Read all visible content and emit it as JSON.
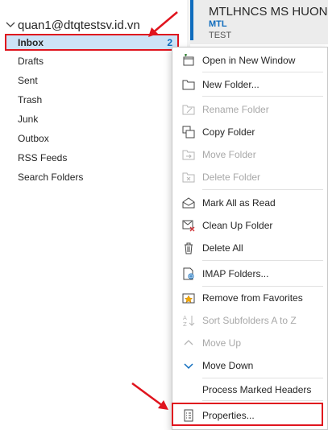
{
  "folder_pane": {
    "account": "quan1@dtqtestsv.id.vn",
    "inbox": {
      "label": "Inbox",
      "count": "2"
    },
    "folders": [
      "Drafts",
      "Sent",
      "Trash",
      "Junk",
      "Outbox",
      "RSS Feeds",
      "Search Folders"
    ]
  },
  "message": {
    "sender": "MTLHNCS MS HUONG",
    "tag": "MTL",
    "subject": "TEST"
  },
  "context_menu": {
    "open_new_window": "Open in New Window",
    "new_folder": "New Folder...",
    "rename_folder": "Rename Folder",
    "copy_folder": "Copy Folder",
    "move_folder": "Move Folder",
    "delete_folder": "Delete Folder",
    "mark_all_read": "Mark All as Read",
    "clean_up_folder": "Clean Up Folder",
    "delete_all": "Delete All",
    "imap_folders": "IMAP Folders...",
    "remove_favorites": "Remove from Favorites",
    "sort_subfolders": "Sort Subfolders A to Z",
    "move_up": "Move Up",
    "move_down": "Move Down",
    "process_headers": "Process Marked Headers",
    "properties": "Properties..."
  },
  "colors": {
    "accent": "#0f6cbd",
    "annotation_red": "#e0141e",
    "selected_bg": "#cde3f7",
    "disabled_text": "#a8a8a8"
  }
}
